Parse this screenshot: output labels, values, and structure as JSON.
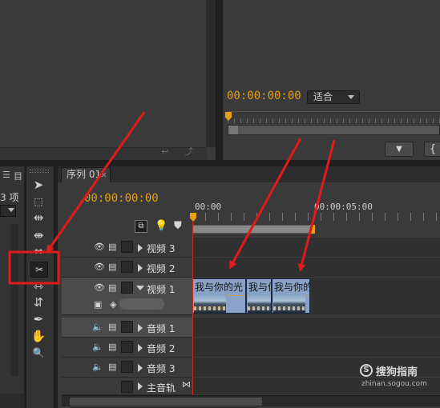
{
  "source_monitor": {
    "corner_icons": "↩ ⤴"
  },
  "program_monitor": {
    "timecode": "00:00:00:00",
    "fit_select": "适合",
    "marker_button": "▼",
    "brace_button": "{"
  },
  "project_panel": {
    "tab_label": "目",
    "items_count": "3 项"
  },
  "tools": {
    "selection": "➤",
    "track_select": "⬚",
    "ripple_edit": "⇹",
    "rolling_edit": "⇼",
    "rate_stretch": "⇔",
    "razor": "✂",
    "slip": "⇿",
    "slide": "⇵",
    "pen": "✒",
    "hand": "✋",
    "zoom": "🔍"
  },
  "timeline": {
    "tab_label": "序列 01",
    "tab_close": "×",
    "timecode": "00:00:00:00",
    "ruler_start": "00:00",
    "ruler_mark": "00:00:05:00",
    "video_tracks": [
      {
        "name": "视频 3"
      },
      {
        "name": "视频 2"
      },
      {
        "name": "视频 1"
      }
    ],
    "audio_tracks": [
      {
        "name": "音频 1"
      },
      {
        "name": "音频 2"
      },
      {
        "name": "音频 3"
      }
    ],
    "master_track": "主音轨",
    "clips": [
      {
        "title": "我与你的光"
      },
      {
        "title": "我与你的"
      },
      {
        "title": "我与你的"
      }
    ]
  },
  "watermark": {
    "text": "搜狗指南",
    "url": "zhinan.sogou.com",
    "logo": "S"
  },
  "colors": {
    "accent": "#e8a012",
    "annotation": "#e11a1a",
    "clip": "#8aa2c7"
  }
}
